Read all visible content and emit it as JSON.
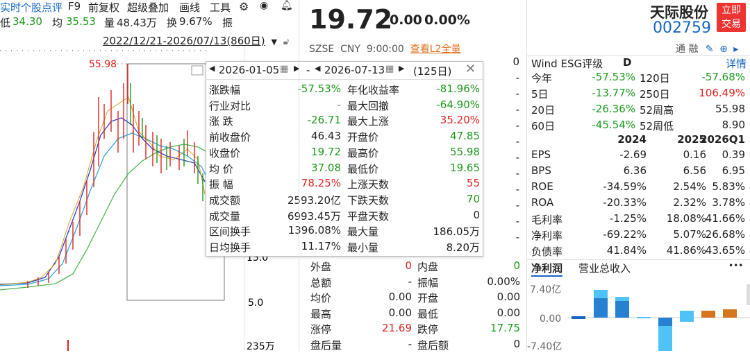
{
  "toolbar": {
    "comment": "实时个股点评",
    "f9": "F9",
    "adjust": "前复权",
    "overlay": "超级叠加",
    "draw": "画线",
    "tools": "工具",
    "gear_icon": "gear-icon",
    "eye_icon": "eye-icon",
    "bell_icon": "bell-icon"
  },
  "stats": {
    "low_label": "低",
    "low_value": "34.30",
    "avg_label": "均",
    "avg_value": "35.53",
    "vol_label": "量",
    "vol_value": "48.43万",
    "turnover_label": "换",
    "turnover_value": "9.67%",
    "amp_label": "振"
  },
  "range": {
    "text": "2022/12/21-2026/07/13(860日)"
  },
  "chart": {
    "high_marker": "55.98",
    "ytick_15": "15.0",
    "ytick_5": "5.0",
    "volume_max": "235万"
  },
  "popup": {
    "start_date": "2026-01-05",
    "end_date": "2026-07-13",
    "days": "(125日)",
    "rows": [
      {
        "l1": "涨跌幅",
        "v1": "-57.53%",
        "c1": "green",
        "l2": "年化收益率",
        "v2": "-81.96%",
        "c2": "green"
      },
      {
        "l1": "行业对比",
        "v1": "-",
        "c1": "gray",
        "l2": "最大回撤",
        "v2": "-64.90%",
        "c2": "green"
      },
      {
        "l1": "涨 跌",
        "v1": "-26.71",
        "c1": "green",
        "l2": "最大上涨",
        "v2": "35.20%",
        "c2": "red"
      },
      {
        "l1": "前收盘价",
        "v1": "46.43",
        "c1": "dark",
        "l2": "开盘价",
        "v2": "47.85",
        "c2": "green"
      },
      {
        "l1": "收盘价",
        "v1": "19.72",
        "c1": "green",
        "l2": "最高价",
        "v2": "55.98",
        "c2": "green"
      },
      {
        "l1": "均 价",
        "v1": "37.08",
        "c1": "green",
        "l2": "最低价",
        "v2": "19.65",
        "c2": "green"
      },
      {
        "l1": "振 幅",
        "v1": "78.25%",
        "c1": "red",
        "l2": "上涨天数",
        "v2": "55",
        "c2": "red"
      },
      {
        "l1": "成交额",
        "v1": "2593.20亿",
        "c1": "dark",
        "l2": "下跌天数",
        "v2": "70",
        "c2": "green"
      },
      {
        "l1": "成交量",
        "v1": "6993.45万",
        "c1": "dark",
        "l2": "平盘天数",
        "v2": "0",
        "c2": "dark"
      },
      {
        "l1": "区间换手",
        "v1": "1396.08%",
        "c1": "dark",
        "l2": "最大量",
        "v2": "186.05万",
        "c2": "dark"
      },
      {
        "l1": "日均换手",
        "v1": "11.17%",
        "c1": "dark",
        "l2": "最小量",
        "v2": "8.20万",
        "c2": "dark"
      }
    ]
  },
  "quote": {
    "price": "19.72",
    "change": "0.00",
    "change_pct": "0.00%",
    "exchange": "SZSE",
    "currency": "CNY",
    "time": "9:00:00",
    "l2_link": "查看L2全量",
    "rows": [
      {
        "l1": "外盘",
        "v1": "0",
        "c1": "red",
        "l2": "内盘",
        "v2": "0",
        "c2": "green"
      },
      {
        "l1": "总额",
        "v1": "-",
        "c1": "dark",
        "l2": "振幅",
        "v2": "0.00%",
        "c2": "dark"
      },
      {
        "l1": "均价",
        "v1": "0.00",
        "c1": "dark",
        "l2": "开盘",
        "v2": "0.00",
        "c2": "dark"
      },
      {
        "l1": "最高",
        "v1": "0.00",
        "c1": "dark",
        "l2": "最低",
        "v2": "0.00",
        "c2": "dark"
      },
      {
        "l1": "涨停",
        "v1": "21.69",
        "c1": "red",
        "l2": "跌停",
        "v2": "17.75",
        "c2": "green"
      },
      {
        "l1": "盘后量",
        "v1": "-",
        "c1": "dark",
        "l2": "盘后额",
        "v2": "0",
        "c2": "dark"
      }
    ],
    "side_values": [
      "0",
      "-",
      "-",
      "-",
      "-",
      "-",
      "-",
      "-",
      "-",
      "-",
      "-",
      "-"
    ]
  },
  "right": {
    "company_name": "天际股份",
    "code": "002759",
    "trade_btn_1": "立即",
    "trade_btn_2": "交易",
    "tab_tongrong": "通 融",
    "esg_label": "Wind ESG评级",
    "esg_rating": "D",
    "detail_link": "详情",
    "perf": [
      {
        "l1": "今年",
        "v1": "-57.53%",
        "c1": "green",
        "l2": "120日",
        "v2": "-57.68%",
        "c2": "green"
      },
      {
        "l1": "5日",
        "v1": "-13.77%",
        "c1": "green",
        "l2": "250日",
        "v2": "106.49%",
        "c2": "red"
      },
      {
        "l1": "20日",
        "v1": "-26.36%",
        "c1": "green",
        "l2": "52周高",
        "v2": "55.98",
        "c2": "dark"
      },
      {
        "l1": "60日",
        "v1": "-45.54%",
        "c1": "green",
        "l2": "52周低",
        "v2": "8.90",
        "c2": "dark"
      }
    ],
    "fin_headers": [
      "2024",
      "2025",
      "2026Q1"
    ],
    "fin": [
      {
        "label": "EPS",
        "vals": [
          "-2.69",
          "0.16",
          "0.39"
        ]
      },
      {
        "label": "BPS",
        "vals": [
          "6.36",
          "6.56",
          "6.95"
        ]
      },
      {
        "label": "ROE",
        "vals": [
          "-34.59%",
          "2.54%",
          "5.83%"
        ]
      },
      {
        "label": "ROA",
        "vals": [
          "-20.33%",
          "2.32%",
          "3.78%"
        ]
      },
      {
        "label": "毛利率",
        "vals": [
          "-1.25%",
          "18.08%",
          "41.66%"
        ]
      },
      {
        "label": "净利率",
        "vals": [
          "-69.22%",
          "5.07%",
          "26.68%"
        ]
      },
      {
        "label": "负债率",
        "vals": [
          "41.84%",
          "41.86%",
          "43.65%"
        ]
      }
    ],
    "bar_tab_1": "净利润",
    "bar_tab_2": "营业总收入",
    "more": "•••",
    "bar_ytick_top": "7.40亿",
    "bar_ytick_mid": "0.00",
    "bar_ytick_bot": "-7.40亿"
  },
  "colors": {
    "up": "#e02020",
    "down": "#1a9a1a",
    "accent": "#1565c0",
    "trade_button": "#e33333"
  }
}
